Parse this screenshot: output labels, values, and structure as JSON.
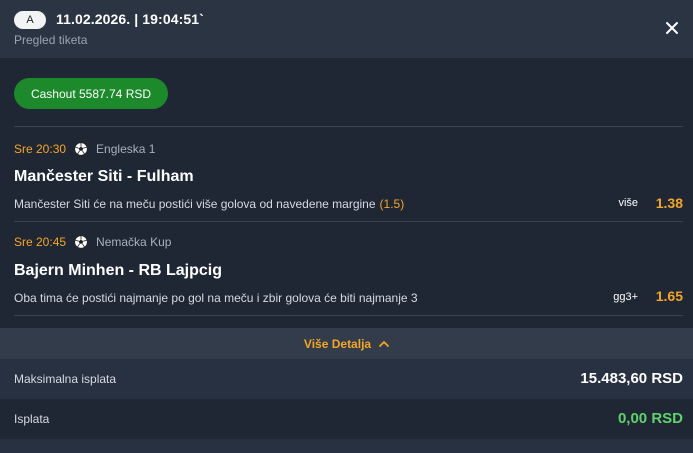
{
  "header": {
    "badge": "A",
    "datetime": "11.02.2026. | 19:04:51`",
    "subtitle": "Pregled tiketa",
    "close_icon": "close-icon"
  },
  "cashout": {
    "label": "Cashout 5587.74 RSD"
  },
  "events": [
    {
      "time": "Sre 20:30",
      "league": "Engleska 1",
      "sport_icon": "soccer-ball-icon",
      "title": "Mančester Siti - Fulham",
      "description": "Mančester Siti će na meču postići više golova od navedene margine",
      "margin": "(1.5)",
      "pick": "više",
      "odd": "1.38"
    },
    {
      "time": "Sre 20:45",
      "league": "Nemačka Kup",
      "sport_icon": "soccer-ball-icon",
      "title": "Bajern Minhen - RB Lajpcig",
      "description": "Oba tima će postići najmanje po gol na meču i zbir golova će biti najmanje 3",
      "margin": "",
      "pick": "gg3+",
      "odd": "1.65"
    }
  ],
  "details": {
    "label": "Više Detalja",
    "icon": "chevron-up-icon"
  },
  "summary": {
    "max_payout_label": "Maksimalna isplata",
    "max_payout_value": "15.483,60 RSD",
    "payout_label": "Isplata",
    "payout_value": "0,00 RSD"
  },
  "colors": {
    "accent": "#f5a623",
    "cashout_green": "#1c8a2b",
    "payout_green": "#5fd36a",
    "background": "#1f2735",
    "header_bg": "#2b3443"
  }
}
